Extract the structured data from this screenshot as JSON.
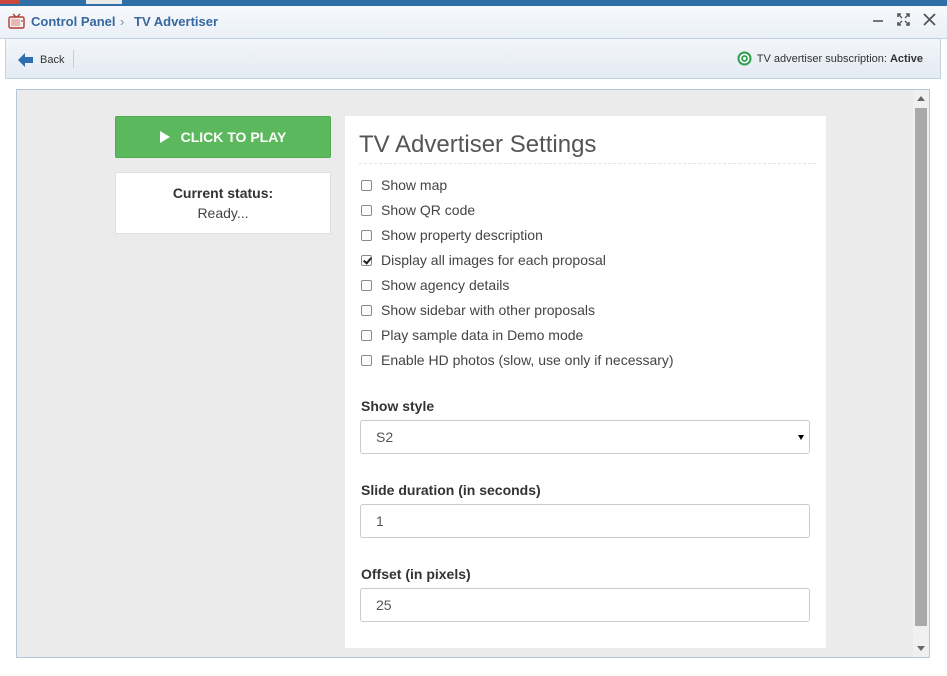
{
  "breadcrumb": {
    "root": "Control Panel",
    "separator": "›",
    "current": "TV Advertiser"
  },
  "window_controls": {
    "minimize": "–",
    "maximize": "⛶",
    "close": "✕"
  },
  "toolbar": {
    "back_label": "Back",
    "subscription_label": "TV advertiser subscription:",
    "subscription_value": "Active"
  },
  "player": {
    "play_label": "CLICK TO PLAY",
    "status_label": "Current status:",
    "status_value": "Ready..."
  },
  "settings": {
    "title": "TV Advertiser Settings",
    "options": [
      {
        "label": "Show map",
        "checked": false
      },
      {
        "label": "Show QR code",
        "checked": false
      },
      {
        "label": "Show property description",
        "checked": false
      },
      {
        "label": "Display all images for each proposal",
        "checked": true
      },
      {
        "label": "Show agency details",
        "checked": false
      },
      {
        "label": "Show sidebar with other proposals",
        "checked": false
      },
      {
        "label": "Play sample data in Demo mode",
        "checked": false
      },
      {
        "label": "Enable HD photos (slow, use only if necessary)",
        "checked": false
      }
    ],
    "show_style": {
      "label": "Show style",
      "value": "S2"
    },
    "slide_duration": {
      "label": "Slide duration (in seconds)",
      "value": "1"
    },
    "offset": {
      "label": "Offset (in pixels)",
      "value": "25"
    }
  },
  "colors": {
    "accent": "#36689e",
    "play": "#5cb85c",
    "active": "#2e9d4d"
  }
}
